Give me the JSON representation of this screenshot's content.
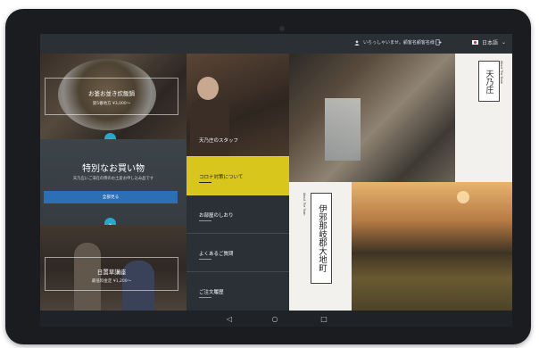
{
  "topbar": {
    "greeting": "いらっしゃいませ。顧客名顧客名様",
    "language": "日本語"
  },
  "left_panels": {
    "rice_title": "お釜お並き炊飯鍋",
    "rice_subtitle": "第5番地方 ¥3,000〜",
    "shopping_title": "特別なお買い物",
    "shopping_subtitle": "天乃庄にご滞在の際のお土産お申し込み品です",
    "shopping_button": "全部見る",
    "workshop_title": "日置草講座",
    "workshop_subtitle": "最低料金定 ¥1,200〜"
  },
  "menu": {
    "staff": "天乃庄のスタッフ",
    "corona": "コロナ対策について",
    "room_guide": "お部屋のしおり",
    "faq": "よくあるご質問",
    "order_history": "ご注文履歴"
  },
  "right_tiles": {
    "tennosho_title": "天乃庄",
    "tennosho_small": "About The Store",
    "izanami_title": "伊邪那岐郡大地町",
    "izanami_small": "About The Town"
  },
  "navbar": {
    "back": "◁",
    "home": "○",
    "recent": "□"
  },
  "colors": {
    "accent_yellow": "#d9c61c",
    "button_blue": "#2d6fb5",
    "circle_cyan": "#29a6c9"
  }
}
